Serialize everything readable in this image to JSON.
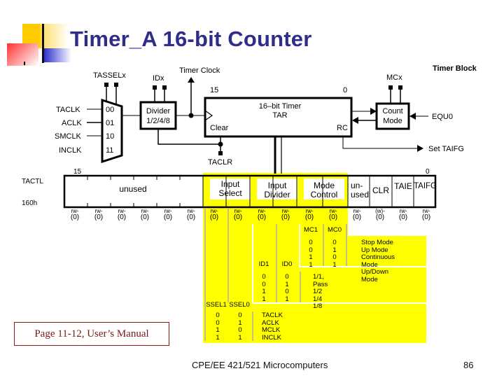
{
  "slide": {
    "title": "Timer_A 16-bit Counter",
    "manual_ref": "Page 11-12, User’s Manual",
    "footer": "CPE/EE 421/521 Microcomputers",
    "page_number": "86"
  },
  "block_diagram": {
    "heading": "Timer Block",
    "tasselx": "TASSELx",
    "idx": "IDx",
    "timer_clock": "Timer Clock",
    "mcx": "MCx",
    "inputs": [
      "TACLK",
      "ACLK",
      "SMCLK",
      "INCLK"
    ],
    "mux_codes": [
      "00",
      "01",
      "10",
      "11"
    ],
    "divider_line1": "Divider",
    "divider_line2": "1/2/4/8",
    "tar_msb": "15",
    "tar_lsb": "0",
    "tar_line1": "16–bit Timer",
    "tar_line2": "TAR",
    "clear": "Clear",
    "rc": "RC",
    "count_line1": "Count",
    "count_line2": "Mode",
    "equ0": "EQU0",
    "set_taifg": "Set TAIFG",
    "taclr": "TACLR"
  },
  "register": {
    "name": "TACTL",
    "address": "160h",
    "msb": "15",
    "lsb": "0",
    "fields": {
      "unused": "unused",
      "input_select": [
        "Input",
        "Select"
      ],
      "input_divider": [
        "Input",
        "Divider"
      ],
      "mode_control": [
        "Mode",
        "Control"
      ],
      "unused2": [
        "un-",
        "used"
      ],
      "clr": "CLR",
      "taie": "TAIE",
      "taifg": "TAIFG"
    },
    "access": [
      {
        "type": "rw-",
        "reset": "(0)"
      },
      {
        "type": "rw-",
        "reset": "(0)"
      },
      {
        "type": "rw-",
        "reset": "(0)"
      },
      {
        "type": "rw-",
        "reset": "(0)"
      },
      {
        "type": "rw-",
        "reset": "(0)"
      },
      {
        "type": "rw-",
        "reset": "(0)"
      },
      {
        "type": "rw-",
        "reset": "(0)"
      },
      {
        "type": "rw-",
        "reset": "(0)"
      },
      {
        "type": "rw-",
        "reset": "(0)"
      },
      {
        "type": "rw-",
        "reset": "(0)"
      },
      {
        "type": "rw-",
        "reset": "(0)"
      },
      {
        "type": "rw-",
        "reset": "(0)"
      },
      {
        "type": "rw-",
        "reset": "(0)"
      },
      {
        "type": "(w)-",
        "reset": "(0)"
      },
      {
        "type": "rw-",
        "reset": "(0)"
      },
      {
        "type": "rw-",
        "reset": "(0)"
      }
    ]
  },
  "mode_table": {
    "headers": [
      "MC1",
      "MC0"
    ],
    "mc1": [
      "0",
      "0",
      "1",
      "1"
    ],
    "mc0": [
      "0",
      "1",
      "0",
      "1"
    ],
    "desc": [
      "Stop Mode",
      "Up Mode",
      "Continuous Mode",
      "Up/Down Mode"
    ]
  },
  "divider_table": {
    "headers": [
      "ID1",
      "ID0"
    ],
    "id1": [
      "0",
      "0",
      "1",
      "1"
    ],
    "id0": [
      "0",
      "1",
      "0",
      "1"
    ],
    "desc": [
      "1/1, Pass",
      "1/2",
      "1/4",
      "1/8"
    ]
  },
  "source_table": {
    "headers": [
      "SSEL1",
      "SSEL0"
    ],
    "ssel1": [
      "0",
      "0",
      "1",
      "1"
    ],
    "ssel0": [
      "0",
      "1",
      "0",
      "1"
    ],
    "desc": [
      "TACLK",
      "ACLK",
      "MCLK",
      "INCLK"
    ]
  }
}
